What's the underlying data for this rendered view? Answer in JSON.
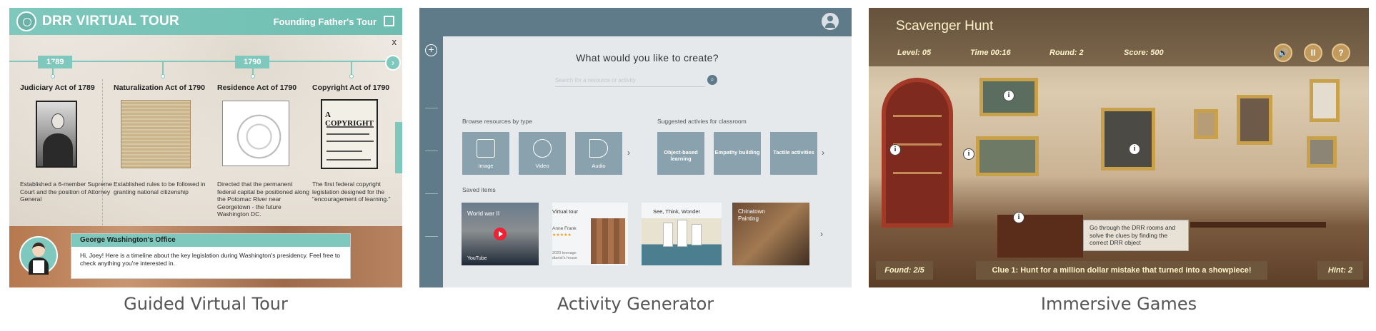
{
  "panel1": {
    "caption": "Guided Virtual Tour",
    "title": "DRR VIRTUAL TOUR",
    "tour_name": "Founding Father's Tour",
    "close_label": "x",
    "year_markers": [
      "1789",
      "1790"
    ],
    "next_label": "›",
    "events": [
      {
        "title": "Judiciary Act of 1789",
        "description": "Established a 6-member Supreme Court and the position of Attorney General"
      },
      {
        "title": "Naturalization Act of 1790",
        "description": "Established rules to be followed in granting national citizenship"
      },
      {
        "title": "Residence Act of 1790",
        "description": "Directed that the permanent federal capital be positioned along the Potomac River near Georgetown - the future Washington DC."
      },
      {
        "title": "Copyright Act of 1790",
        "description": "The first federal copyright legislation designed for the \"encouragement of learning.\""
      }
    ],
    "copyright_art_text": "A COPYRIGHT",
    "guide": {
      "header": "George Washington's Office",
      "message": "Hi, Joey! Here is a timeline about the key legislation during Washington's presidency. Feel free to check anything you're interested in."
    }
  },
  "panel2": {
    "caption": "Activity Generator",
    "plus_label": "+",
    "prompt": "What would you like to create?",
    "search_placeholder": "Search for a resource or activity",
    "browse_label": "Browse resources by type",
    "resource_types": [
      "Image",
      "Video",
      "Audio"
    ],
    "suggested_label": "Suggested activies for classroom",
    "activities": [
      "Object-based learning",
      "Empathy building",
      "Tactile activities"
    ],
    "chevron": "›",
    "saved_label": "Saved items",
    "saved_items": {
      "world_war": {
        "title": "World war II",
        "source": "YouTube"
      },
      "virtual_tour": {
        "title": "Virtual tour",
        "name": "Anne Frank",
        "stars": "★★★★★",
        "desc": "2020 teenage diarist's house"
      },
      "see_think": {
        "title": "See, Think, Wonder"
      },
      "chinatown": {
        "title": "Chinatown Painting"
      }
    }
  },
  "panel3": {
    "caption": "Immersive Games",
    "game_title": "Scavenger Hunt",
    "level": "Level: 05",
    "time": "Time 00:16",
    "round": "Round: 2",
    "score": "Score: 500",
    "buttons": {
      "sound": "🔊",
      "pause": "II",
      "help": "?"
    },
    "info_marker": "i",
    "tooltip": "Go through the DRR rooms and solve the clues by finding the correct DRR object",
    "found": "Found: 2/5",
    "clue": "Clue 1: Hunt for a million dollar mistake that turned into a showpiece!",
    "hint": "Hint: 2"
  }
}
